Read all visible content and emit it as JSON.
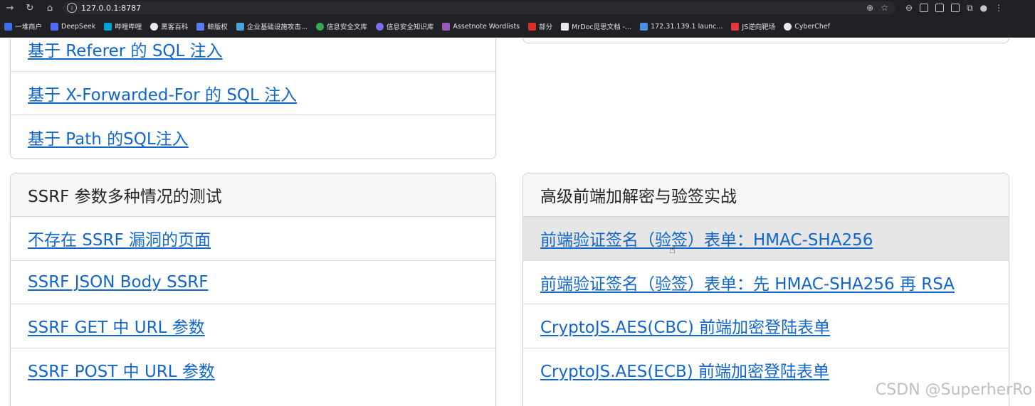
{
  "browser": {
    "url": "127.0.0.1:8787",
    "bookmarks": [
      {
        "label": "一堆商户",
        "color": "#3b6ee8"
      },
      {
        "label": "DeepSeek",
        "color": "#4d6bfe"
      },
      {
        "label": "哔哩哔哩",
        "color": "#00a1d6"
      },
      {
        "label": "黑客百科",
        "color": "#e8e8e8"
      },
      {
        "label": "鲸版权",
        "color": "#5b7cf0"
      },
      {
        "label": "企业基础设施攻击...",
        "color": "#4aa3df"
      },
      {
        "label": "信息安全文库",
        "color": "#34a853"
      },
      {
        "label": "信息安全知识库",
        "color": "#7c6cf0"
      },
      {
        "label": "Assetnote Wordlists",
        "color": "#9b59b6"
      },
      {
        "label": "部分",
        "color": "#d93025"
      },
      {
        "label": "MrDoc觅思文档 -...",
        "color": "#e8e8e8"
      },
      {
        "label": "172.31.139.1 launc...",
        "color": "#4a90e2"
      },
      {
        "label": "JS逆向靶场",
        "color": "#e53935"
      },
      {
        "label": "CyberChef",
        "color": "#e8e8e8"
      }
    ]
  },
  "left_top_card": {
    "items": [
      {
        "label": "基于 Referer 的 SQL 注入"
      },
      {
        "label": "基于 X-Forwarded-For 的 SQL 注入"
      },
      {
        "label": "基于 Path 的SQL注入"
      }
    ]
  },
  "ssrf_card": {
    "title": "SSRF 参数多种情况的测试",
    "items": [
      {
        "label": "不存在 SSRF 漏洞的页面"
      },
      {
        "label": "SSRF JSON Body SSRF"
      },
      {
        "label": "SSRF GET 中 URL 参数"
      },
      {
        "label": "SSRF POST 中 URL 参数"
      }
    ]
  },
  "crypto_card": {
    "title": "高级前端加解密与验签实战",
    "items": [
      {
        "label": "前端验证签名（验签）表单：HMAC-SHA256"
      },
      {
        "label": "前端验证签名（验签）表单：先 HMAC-SHA256 再 RSA"
      },
      {
        "label": "CryptoJS.AES(CBC) 前端加密登陆表单"
      },
      {
        "label": "CryptoJS.AES(ECB) 前端加密登陆表单"
      }
    ]
  },
  "watermark": "CSDN @SuperherRo",
  "colors": {
    "link": "#1166cc",
    "header_bg": "#f7f7f7",
    "hover_bg": "#e6e6e6"
  }
}
